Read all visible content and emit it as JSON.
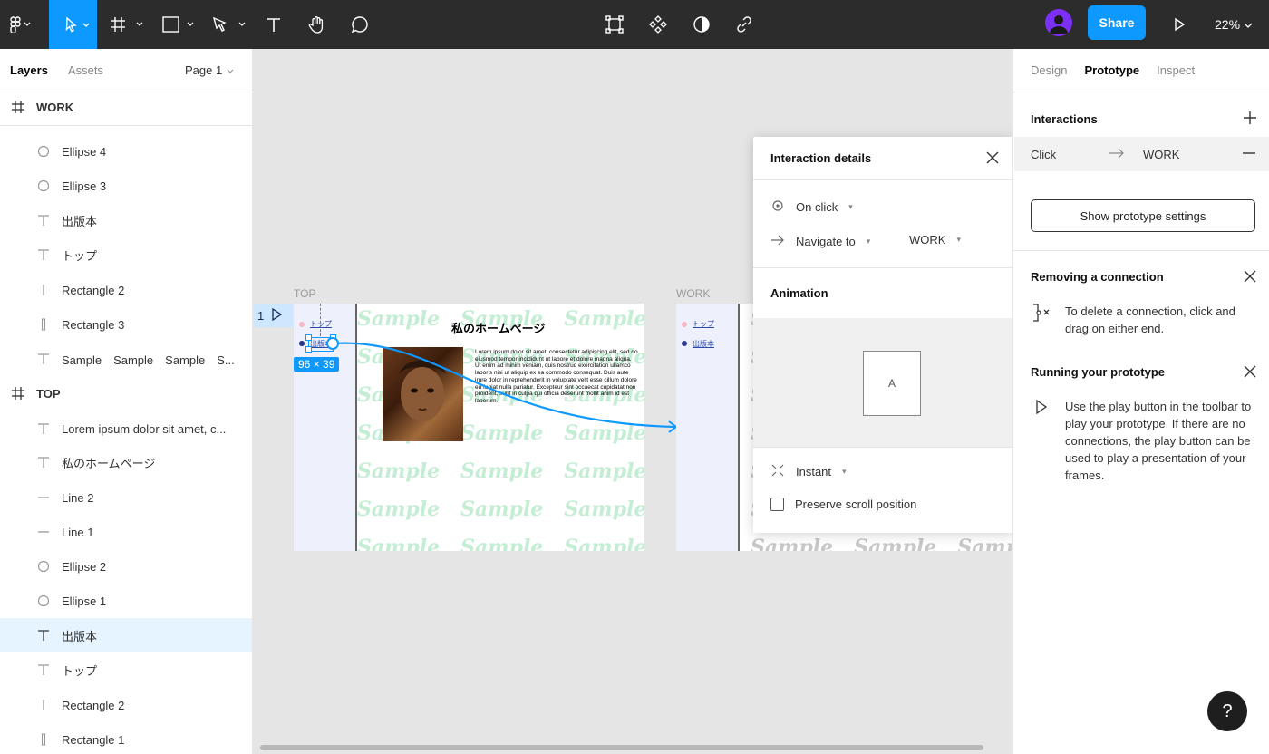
{
  "toolbar": {
    "zoom": "22%",
    "share_label": "Share",
    "accent": "#0d99ff"
  },
  "left_panel": {
    "tabs": [
      "Layers",
      "Assets"
    ],
    "page_selector": "Page 1",
    "layers": [
      {
        "name": "WORK",
        "icon": "frame-icon",
        "type": "frame"
      },
      {
        "name": "Ellipse 4",
        "icon": "ellipse-icon"
      },
      {
        "name": "Ellipse 3",
        "icon": "ellipse-icon"
      },
      {
        "name": "出版本",
        "icon": "text-icon"
      },
      {
        "name": "トップ",
        "icon": "text-icon"
      },
      {
        "name": "Rectangle 2",
        "icon": "line-vertical-icon"
      },
      {
        "name": "Rectangle 3",
        "icon": "rectangle-vertical-icon"
      },
      {
        "name": "Sample　Sample　Sample　S...",
        "icon": "text-icon"
      },
      {
        "name": "TOP",
        "icon": "frame-icon",
        "type": "frame"
      },
      {
        "name": "Lorem ipsum dolor sit amet, c...",
        "icon": "text-icon"
      },
      {
        "name": "私のホームページ",
        "icon": "text-icon"
      },
      {
        "name": "Line 2",
        "icon": "line-icon"
      },
      {
        "name": "Line 1",
        "icon": "line-icon"
      },
      {
        "name": "Ellipse 2",
        "icon": "ellipse-icon"
      },
      {
        "name": "Ellipse 1",
        "icon": "ellipse-icon"
      },
      {
        "name": "出版本",
        "icon": "text-icon",
        "selected": true
      },
      {
        "name": "トップ",
        "icon": "text-icon"
      },
      {
        "name": "Rectangle 2",
        "icon": "line-vertical-icon"
      },
      {
        "name": "Rectangle 1",
        "icon": "rectangle-vertical-icon"
      }
    ]
  },
  "canvas": {
    "frame_top_label": "TOP",
    "frame_work_label": "WORK",
    "sample_word": "Sample",
    "nav_top": "トップ",
    "nav_pub": "出版本",
    "page_title": "私のホームページ",
    "size_badge": "96 × 39",
    "proto_flag_number": "1",
    "lorem": "Lorem ipsum dolor sit amet, consectetur adipiscing elit, sed do eiusmod tempor incididunt ut labore et dolore magna aliqua. Ut enim ad minim veniam, quis nostrud exercitation ullamco laboris nisi ut aliquip ex ea commodo consequat. Duis aute irure dolor in reprehenderit in voluptate velit esse cillum dolore eu fugiat nulla pariatur. Excepteur sint occaecat cupidatat non proident, sunt in culpa qui officia deserunt mollit anim id est laborum."
  },
  "popup": {
    "title": "Interaction details",
    "trigger": "On click",
    "action": "Navigate to",
    "destination": "WORK",
    "animation_title": "Animation",
    "preview_letter": "A",
    "transition": "Instant",
    "preserve_scroll": "Preserve scroll position",
    "preserve_checked": false
  },
  "right_panel": {
    "tabs": [
      "Design",
      "Prototype",
      "Inspect"
    ],
    "active_tab": "Prototype",
    "interactions_title": "Interactions",
    "click_trigger": "Click",
    "click_dest": "WORK",
    "show_settings": "Show prototype settings",
    "removing_title": "Removing a connection",
    "removing_text": "To delete a connection, click and drag on either end.",
    "running_title": "Running your prototype",
    "running_text": "Use the play button in the toolbar to play your prototype. If there are no connections, the play button can be used to play a presentation of your frames."
  },
  "help_label": "?"
}
